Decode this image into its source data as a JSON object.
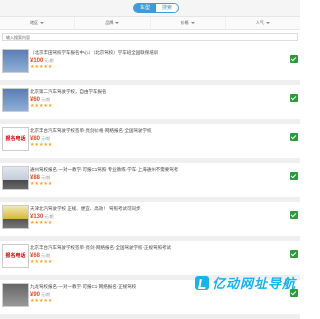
{
  "header": {
    "tabs": [
      {
        "label": "车型",
        "active": true
      },
      {
        "label": "搜索",
        "active": false
      }
    ]
  },
  "filters": [
    {
      "label": "地区"
    },
    {
      "label": "品牌"
    },
    {
      "label": "价格"
    },
    {
      "label": "人气"
    }
  ],
  "search": {
    "placeholder": "输入搜索内容"
  },
  "listings": [
    {
      "title": "（北京丰田驾校学车报名中心）（北京驾校）学车班全国联保培训",
      "price": "¥100",
      "unit": "元/期",
      "rating": 5,
      "thumb_text": "",
      "thumb_style": "t-blue"
    },
    {
      "title": "北京第二汽车驾驶学校，自由学车报名",
      "price": "¥60",
      "unit": "元/期",
      "rating": 5,
      "thumb_text": "",
      "thumb_style": "t-blue"
    },
    {
      "title": "北京丰台汽车驾驶学校签单·亮剑价格·网络报名·全国驾驶学校",
      "price": "¥80",
      "unit": "元/期",
      "rating": 5,
      "thumb_text": "报名电话",
      "thumb_style": "t-red"
    },
    {
      "title": "通州驾校报名·一对一教学·可报C1驾照·专业教练·学车·上海通州不需要驾考",
      "price": "¥88",
      "unit": "元/期",
      "rating": 5,
      "thumb_text": "",
      "thumb_style": "t-car"
    },
    {
      "title": "天津北汽驾驶学校 正规、便宜、高效！ 驾照考试可同步",
      "price": "¥130",
      "unit": "元/期",
      "rating": 5,
      "thumb_text": "",
      "thumb_style": "t-yellow"
    },
    {
      "title": "北京丰台汽车驾驶学校签单·亮剑·网络报名·全国驾驶学校·正规驾照考试",
      "price": "¥68",
      "unit": "元/期",
      "rating": 5,
      "thumb_text": "报名电话",
      "thumb_style": "t-red"
    },
    {
      "title": "九龙驾校报名·一对一教学·可报C1·网络报名·正规驾校",
      "price": "¥90",
      "unit": "元/期",
      "rating": 5,
      "thumb_text": "",
      "thumb_style": "t-dark"
    }
  ],
  "watermark": {
    "text": "亿动网址导航"
  },
  "colors": {
    "accent": "#3d9bd8",
    "price": "#e54a2a",
    "star": "#f5a623",
    "badge": "#2c9b3a",
    "watermark": "#18b3e8"
  }
}
